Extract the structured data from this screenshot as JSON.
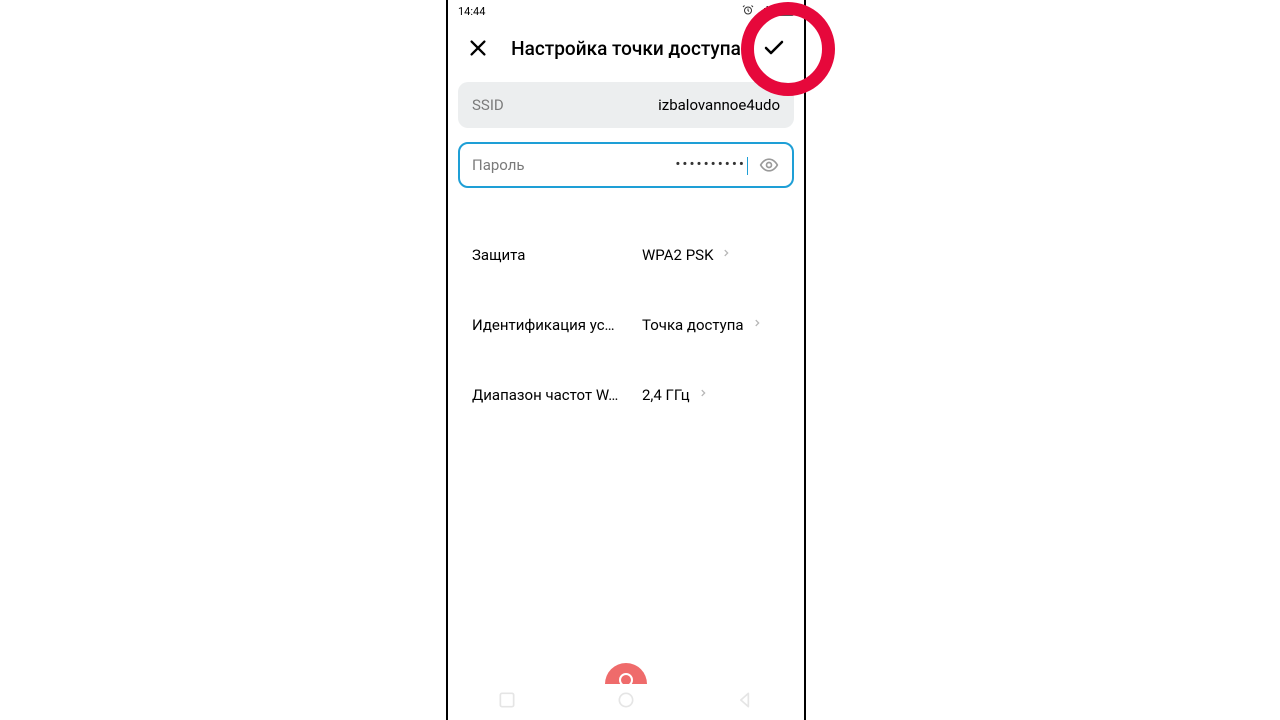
{
  "statusbar": {
    "time": "14:44"
  },
  "header": {
    "title": "Настройка точки доступа"
  },
  "fields": {
    "ssid": {
      "label": "SSID",
      "value": "izbalovannoe4udo"
    },
    "password": {
      "label": "Пароль",
      "value": "••••••••••"
    }
  },
  "rows": {
    "security": {
      "label": "Защита",
      "value": "WPA2 PSK"
    },
    "device_id": {
      "label": "Идентификация ус…",
      "value": "Точка доступа"
    },
    "band": {
      "label": "Диапазон частот W…",
      "value": "2,4 ГГц"
    }
  }
}
